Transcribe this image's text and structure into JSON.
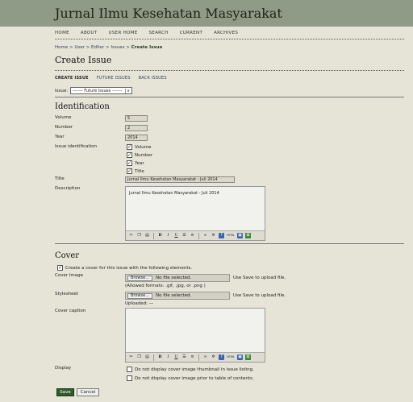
{
  "header": {
    "title": "Jurnal Ilmu Kesehatan Masyarakat"
  },
  "nav": [
    "HOME",
    "ABOUT",
    "USER HOME",
    "SEARCH",
    "CURRENT",
    "ARCHIVES"
  ],
  "breadcrumb": {
    "home": "Home",
    "user": "User",
    "editor": "Editor",
    "issues": "Issues",
    "current": "Create Issue",
    "sep": ">"
  },
  "page_title": "Create Issue",
  "subnav": {
    "create": "CREATE ISSUE",
    "future": "FUTURE ISSUES",
    "back": "BACK ISSUES"
  },
  "issue": {
    "label": "Issue:",
    "selected": "------- Future Issues -------",
    "arrow": "v"
  },
  "identification": {
    "heading": "Identification",
    "volume_label": "Volume",
    "volume_value": "5",
    "number_label": "Number",
    "number_value": "2",
    "year_label": "Year",
    "year_value": "2014",
    "issue_id_label": "Issue identification",
    "checks": [
      "Volume",
      "Number",
      "Year",
      "Title"
    ],
    "title_label": "Title",
    "title_value": "Jurnal Ilmu Kesehatan Masyarakat - Juli 2014",
    "description_label": "Description",
    "description_value": "Jurnal Ilmu Kesehatan Masyarakat - Juli 2014"
  },
  "toolbar_icons": [
    "cut-icon",
    "copy-icon",
    "paste-icon",
    "bold-icon",
    "italic-icon",
    "underline-icon",
    "bullet-list-icon",
    "numbered-list-icon",
    "link-icon",
    "unlink-icon",
    "help-icon",
    "html-icon",
    "fullscreen-icon",
    "image-icon"
  ],
  "toolbar_labels": {
    "bold": "B",
    "italic": "I",
    "underline": "U",
    "html": "HTML"
  },
  "cover": {
    "heading": "Cover",
    "create_label": "Create a cover for this issue with the following elements.",
    "cover_image_label": "Cover image",
    "browse": "Browse...",
    "no_file": "No file selected.",
    "upload_hint": "Use Save to upload file.",
    "formats": "(Allowed formats: .gif, .jpg, or .png )",
    "stylesheet_label": "Stylesheet",
    "uploaded": "Uploaded: —",
    "caption_label": "Cover caption",
    "display_label": "Display",
    "display_opt1": "Do not display cover image thumbnail in issue listing.",
    "display_opt2": "Do not display cover image prior to table of contents."
  },
  "buttons": {
    "save": "Save",
    "cancel": "Cancel"
  },
  "check_glyph": "✓"
}
